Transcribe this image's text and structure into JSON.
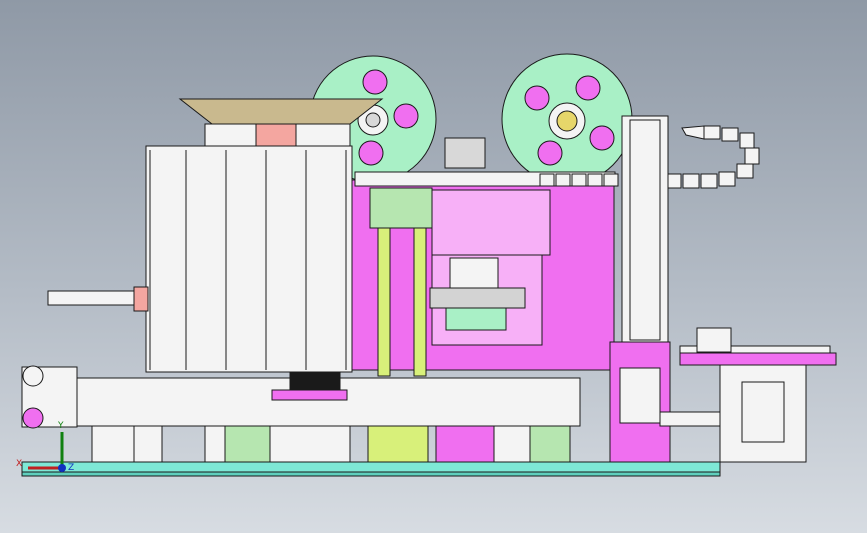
{
  "viewport": {
    "background_top": "#8f99a6",
    "background_bottom": "#d7dce2"
  },
  "colors": {
    "frame": "#f4f4f4",
    "outline": "#1a1a1a",
    "magenta": "#f06ff0",
    "pink": "#f7b0f7",
    "mint": "#a9f0c6",
    "lime": "#d8f07a",
    "cyan_base": "#7ee8d6",
    "green_plate": "#b6e6b0",
    "salmon": "#f4a6a0",
    "hopper": "#c9b98e",
    "purple": "#b43fd0"
  },
  "triad": {
    "x_label": "X",
    "y_label": "Y",
    "z_label": "Z"
  }
}
